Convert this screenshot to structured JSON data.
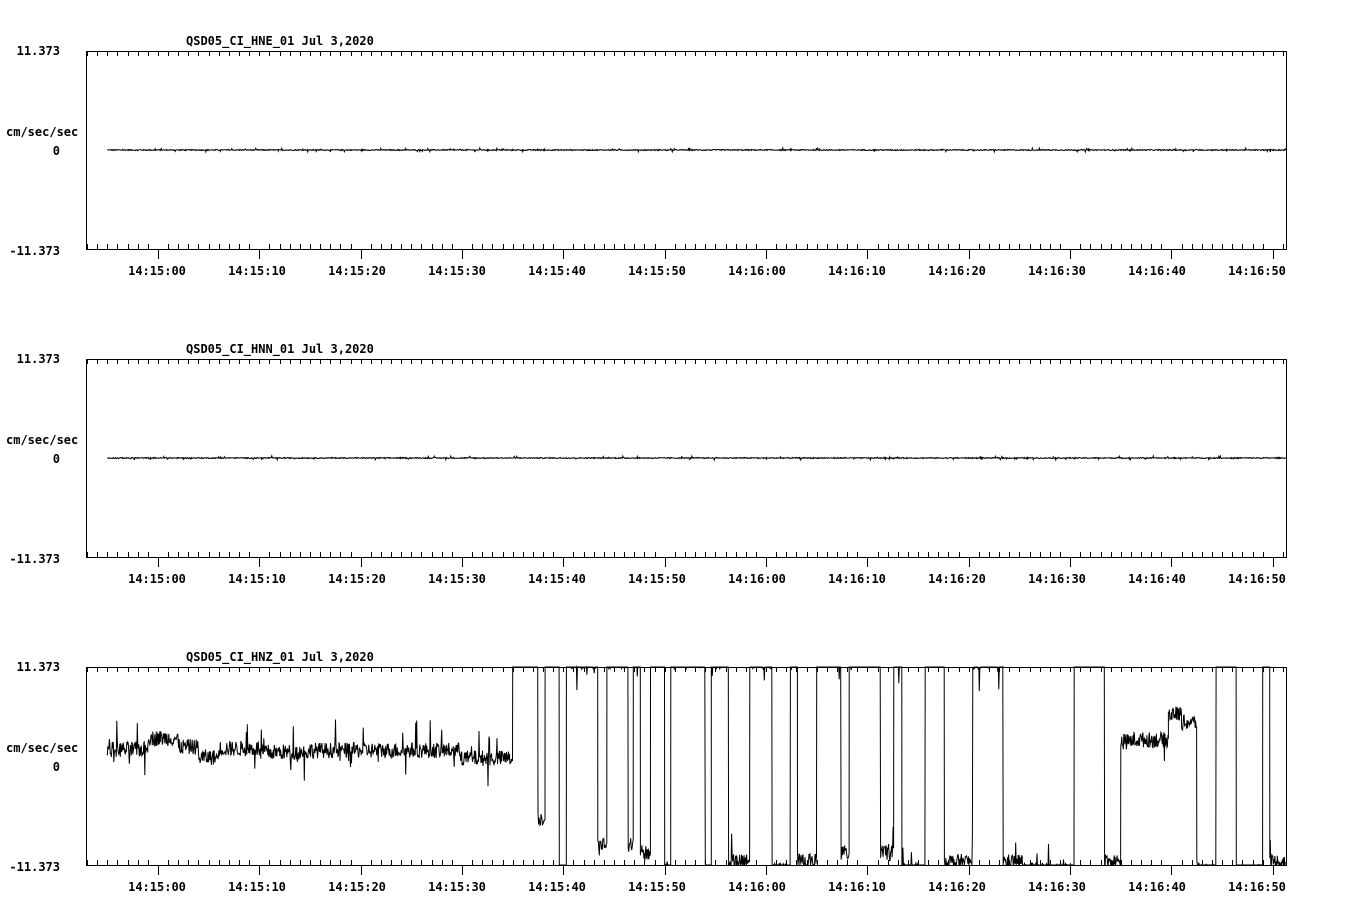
{
  "chart_data": [
    {
      "type": "line",
      "title": "QSD05_CI_HNE_01  Jul 3,2020",
      "ylabel": "cm/sec/sec",
      "y_tick_labels": [
        "11.373",
        "0",
        "-11.373"
      ],
      "ylim": [
        -11.373,
        11.373
      ],
      "x_tick_labels": [
        "14:15:00",
        "14:15:10",
        "14:15:20",
        "14:15:30",
        "14:15:40",
        "14:15:50",
        "14:16:00",
        "14:16:10",
        "14:16:20",
        "14:16:30",
        "14:16:40",
        "14:16:50"
      ],
      "xlim_seconds_past_14_15_00": [
        -7,
        111.3
      ],
      "data_start_seconds": -5,
      "segments": [
        [
          -5,
          111.3,
          0.0
        ]
      ],
      "noise": 0.06,
      "color": "#000000"
    },
    {
      "type": "line",
      "title": "QSD05_CI_HNN_01  Jul 3,2020",
      "ylabel": "cm/sec/sec",
      "y_tick_labels": [
        "11.373",
        "0",
        "-11.373"
      ],
      "ylim": [
        -11.373,
        11.373
      ],
      "x_tick_labels": [
        "14:15:00",
        "14:15:10",
        "14:15:20",
        "14:15:30",
        "14:15:40",
        "14:15:50",
        "14:16:00",
        "14:16:10",
        "14:16:20",
        "14:16:30",
        "14:16:40",
        "14:16:50"
      ],
      "xlim_seconds_past_14_15_00": [
        -7,
        111.3
      ],
      "data_start_seconds": -5,
      "segments": [
        [
          -5,
          111.3,
          0.0
        ]
      ],
      "noise": 0.06,
      "color": "#000000"
    },
    {
      "type": "line",
      "title": "QSD05_CI_HNZ_01  Jul 3,2020",
      "ylabel": "cm/sec/sec",
      "y_tick_labels": [
        "11.373",
        "0",
        "-11.373"
      ],
      "ylim": [
        -11.373,
        11.373
      ],
      "x_tick_labels": [
        "14:15:00",
        "14:15:10",
        "14:15:20",
        "14:15:30",
        "14:15:40",
        "14:15:50",
        "14:16:00",
        "14:16:10",
        "14:16:20",
        "14:16:30",
        "14:16:40",
        "14:16:50"
      ],
      "xlim_seconds_past_14_15_00": [
        -7,
        111.3
      ],
      "data_start_seconds": -5,
      "segments": [
        [
          -5,
          -1,
          1.9
        ],
        [
          -1,
          2,
          3.2
        ],
        [
          2,
          4,
          2.2
        ],
        [
          4,
          6,
          1.0
        ],
        [
          6,
          10,
          2.0
        ],
        [
          10,
          15,
          1.6
        ],
        [
          15,
          20,
          1.8
        ],
        [
          20,
          30,
          1.8
        ],
        [
          30,
          35,
          0.9
        ],
        [
          35,
          37.5,
          13.0
        ],
        [
          37.5,
          38.2,
          -6.0
        ],
        [
          38.2,
          39.6,
          13.0
        ],
        [
          39.6,
          40.3,
          -14.0
        ],
        [
          40.3,
          42.4,
          12.0
        ],
        [
          42.4,
          43.4,
          12.0
        ],
        [
          43.4,
          44.3,
          -9.0
        ],
        [
          44.3,
          46.4,
          12.0
        ],
        [
          46.4,
          46.9,
          -9.0
        ],
        [
          46.9,
          47.6,
          13.0
        ],
        [
          47.6,
          48.6,
          -10.0
        ],
        [
          48.6,
          50,
          13.0
        ],
        [
          50,
          50.6,
          -12.0
        ],
        [
          50.6,
          54,
          12.0
        ],
        [
          54,
          54.6,
          -12.0
        ],
        [
          54.6,
          56.3,
          12.0
        ],
        [
          56.3,
          58.4,
          -11.0
        ],
        [
          58.4,
          60.6,
          12.0
        ],
        [
          60.6,
          62.4,
          -12.0
        ],
        [
          62.4,
          63.1,
          13.0
        ],
        [
          63.1,
          65,
          -11.0
        ],
        [
          65,
          67.4,
          13.0
        ],
        [
          67.4,
          68.2,
          -10.0
        ],
        [
          68.2,
          71.3,
          13.0
        ],
        [
          71.3,
          72.6,
          -10.0
        ],
        [
          72.6,
          73.4,
          13.0
        ],
        [
          73.4,
          75.7,
          -12.0
        ],
        [
          75.7,
          77.6,
          13.0
        ],
        [
          77.6,
          80.4,
          -11.0
        ],
        [
          80.4,
          83.4,
          12.0
        ],
        [
          83.4,
          85.3,
          -11.0
        ],
        [
          85.3,
          90.4,
          -12.0
        ],
        [
          90.4,
          91.4,
          16.0
        ],
        [
          91.4,
          93.4,
          15.0
        ],
        [
          93.4,
          95,
          -11.0
        ],
        [
          95,
          96,
          2.8
        ],
        [
          96,
          99.7,
          3.0
        ],
        [
          99.7,
          101,
          6.0
        ],
        [
          101,
          102.5,
          5.0
        ],
        [
          102.5,
          104.4,
          -12.0
        ],
        [
          104.4,
          106.4,
          15.0
        ],
        [
          106.4,
          108.4,
          -13.0
        ],
        [
          108.4,
          109,
          -12.0
        ],
        [
          109,
          109.7,
          14.0
        ],
        [
          109.7,
          111.3,
          -11.0
        ]
      ],
      "noise": 0.9,
      "color": "#000000"
    }
  ]
}
